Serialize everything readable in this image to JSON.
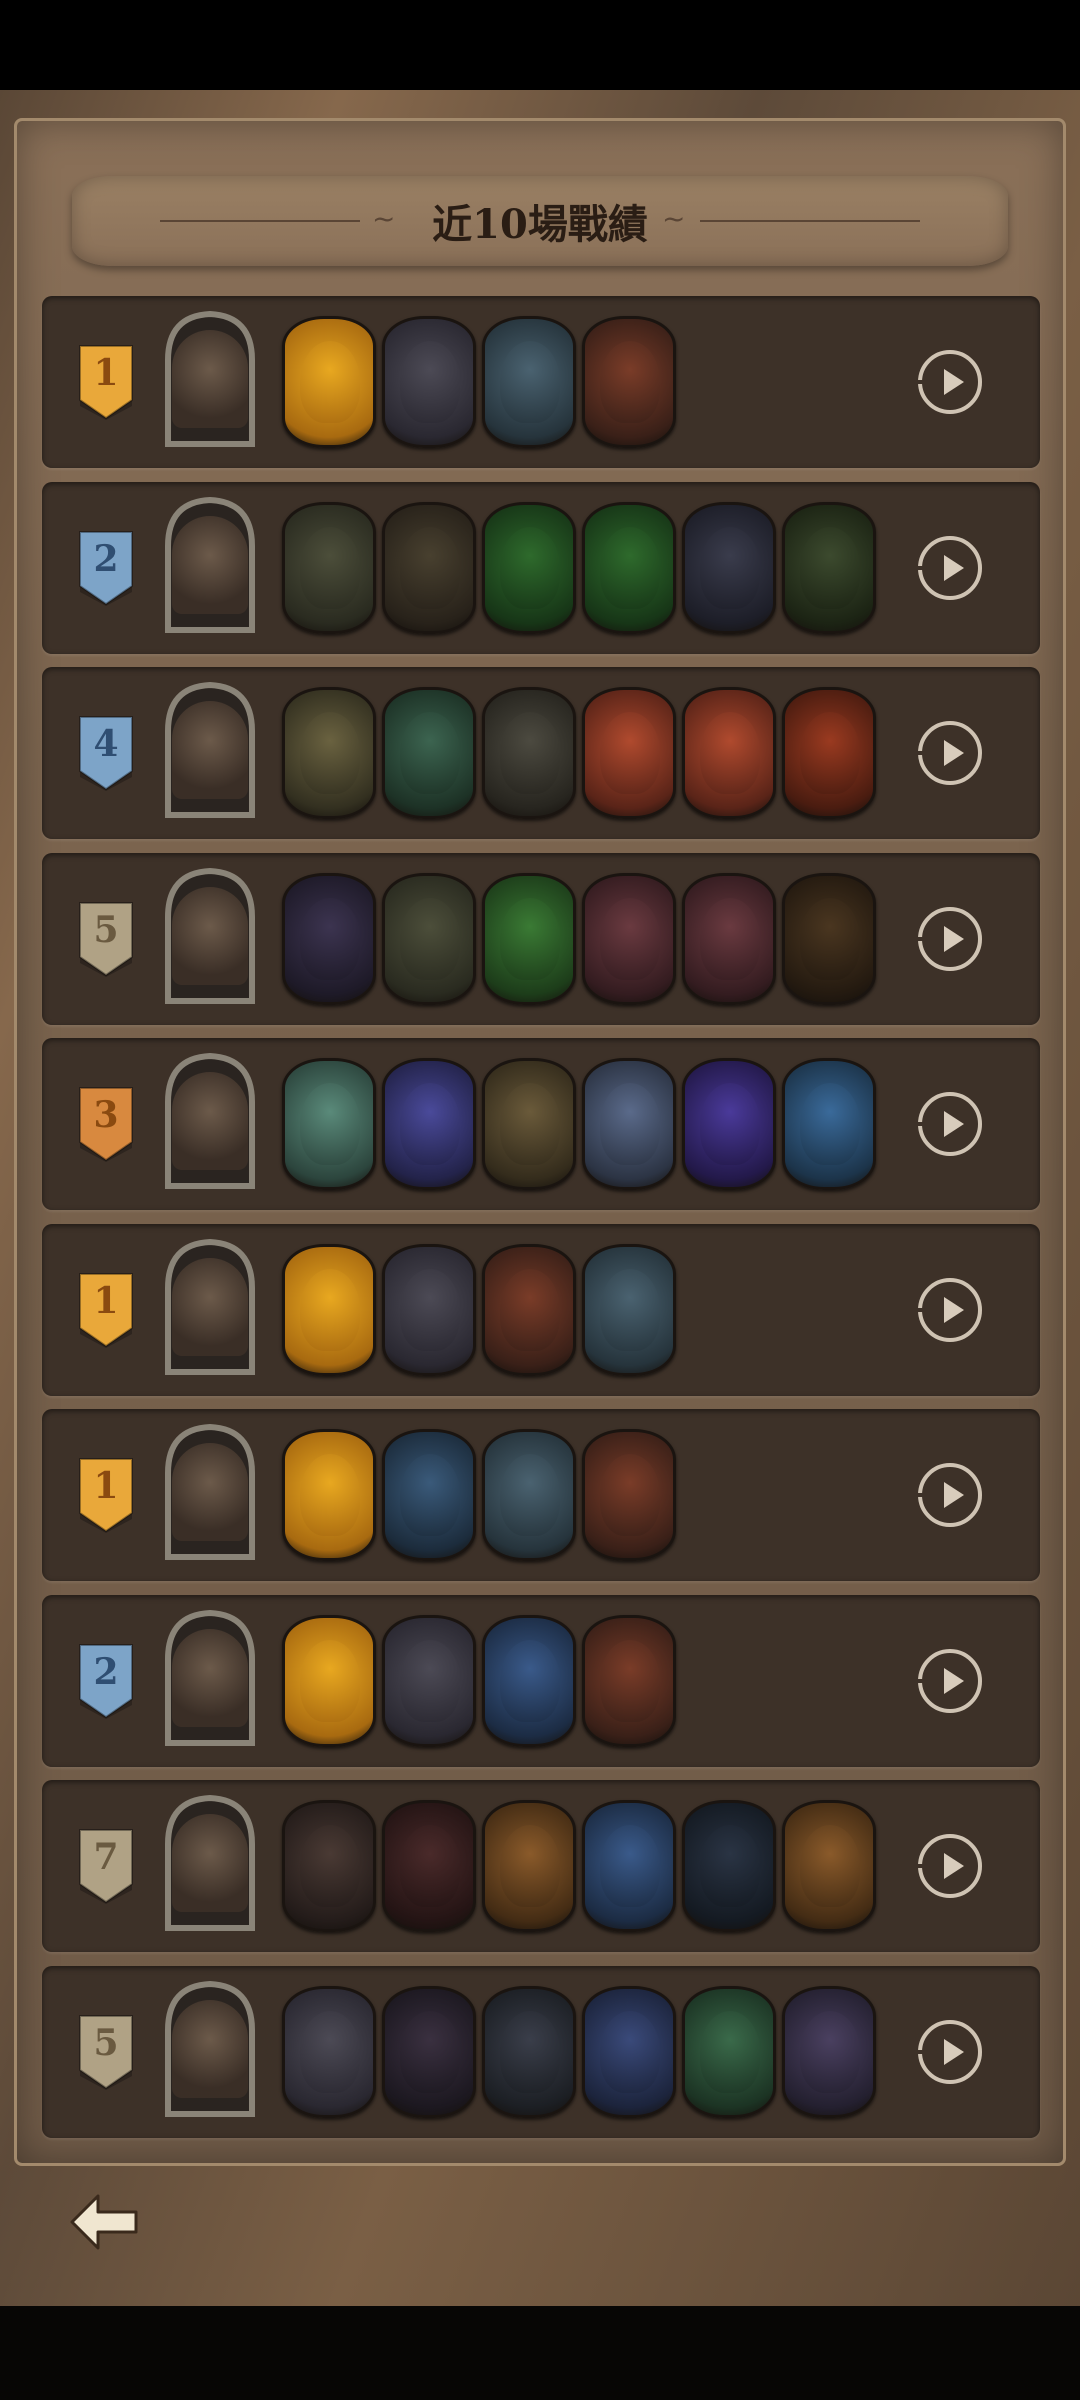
{
  "title": "近10場戰績",
  "colors": {
    "gold": "#e9a83a",
    "blue": "#7da4c8",
    "bronze": "#d8893f",
    "stone": "#b0a285"
  },
  "matches": [
    {
      "rank": "1",
      "badge": "gold",
      "hero": "hero-blue-tophat",
      "units": [
        [
          "golden-flame",
          "#e8a820",
          "#a86a10"
        ],
        [
          "grey-wolf",
          "#4c4a55",
          "#2a2831"
        ],
        [
          "winged-gargoyle",
          "#4a6270",
          "#26343c"
        ],
        [
          "red-dragon",
          "#7a3c28",
          "#3a2018"
        ]
      ]
    },
    {
      "rank": "2",
      "badge": "blue",
      "hero": "hero-antlered-elder",
      "units": [
        [
          "rock-golem",
          "#4c4e3a",
          "#2a2b20"
        ],
        [
          "hedgehog",
          "#48402f",
          "#28221a"
        ],
        [
          "green-treant",
          "#2e6a2c",
          "#173617"
        ],
        [
          "green-treant",
          "#2e6a2c",
          "#173617"
        ],
        [
          "black-horse",
          "#3a3c4c",
          "#1d1e28"
        ],
        [
          "skeleton-witch",
          "#3c4a2e",
          "#1c2414"
        ]
      ]
    },
    {
      "rank": "4",
      "badge": "blue",
      "hero": "hero-dwarf-king",
      "units": [
        [
          "armored-knight",
          "#6a6240",
          "#333020"
        ],
        [
          "lizard-mage",
          "#3c6450",
          "#1d3226"
        ],
        [
          "bearded-warrior",
          "#4c4a40",
          "#27251f"
        ],
        [
          "goblin-bomber",
          "#b04a2e",
          "#5a2418"
        ],
        [
          "goblin-bomber",
          "#b04a2e",
          "#5a2418"
        ],
        [
          "fire-imp",
          "#9a3a20",
          "#4a1c10"
        ]
      ]
    },
    {
      "rank": "5",
      "badge": "stone",
      "hero": "hero-white-haired-lady",
      "units": [
        [
          "dark-elf",
          "#3c3450",
          "#1e1a28"
        ],
        [
          "rock-golem",
          "#4c4e3a",
          "#2a2b20"
        ],
        [
          "cactus",
          "#3a7a34",
          "#1d3d1a"
        ],
        [
          "red-hair-mage",
          "#6a3a40",
          "#341c20"
        ],
        [
          "red-hair-mage",
          "#6a3a40",
          "#341c20"
        ],
        [
          "dark-treant",
          "#4a3620",
          "#241a10"
        ]
      ]
    },
    {
      "rank": "3",
      "badge": "bronze",
      "hero": "hero-gunslinger",
      "units": [
        [
          "sea-serpent",
          "#5a8a7a",
          "#2c453d"
        ],
        [
          "blue-sorceress",
          "#4a4a9a",
          "#23234a"
        ],
        [
          "gold-king",
          "#6a5a3a",
          "#342c1c"
        ],
        [
          "star-boy",
          "#5a6a8a",
          "#2c3444"
        ],
        [
          "purple-dragon",
          "#4a3a9a",
          "#23194a"
        ],
        [
          "ice-spirit",
          "#3a6a9a",
          "#1c344a"
        ]
      ]
    },
    {
      "rank": "1",
      "badge": "gold",
      "hero": "hero-anubis",
      "units": [
        [
          "golden-flame",
          "#e8a820",
          "#a86a10"
        ],
        [
          "grey-wolf",
          "#4c4a55",
          "#2a2831"
        ],
        [
          "red-dragon",
          "#7a3c28",
          "#3a2018"
        ],
        [
          "winged-gargoyle",
          "#4a6270",
          "#26343c"
        ]
      ]
    },
    {
      "rank": "1",
      "badge": "gold",
      "hero": "hero-green-haired-noble",
      "units": [
        [
          "golden-flame",
          "#e8a820",
          "#a86a10"
        ],
        [
          "beast-rider",
          "#3a5a7a",
          "#1c2c3c"
        ],
        [
          "winged-gargoyle",
          "#4a6270",
          "#26343c"
        ],
        [
          "red-dragon",
          "#7a3c28",
          "#3a2018"
        ]
      ]
    },
    {
      "rank": "2",
      "badge": "blue",
      "hero": "hero-antlered-elder",
      "units": [
        [
          "golden-flame",
          "#e8a820",
          "#a86a10"
        ],
        [
          "grey-wolf",
          "#4c4a55",
          "#2a2831"
        ],
        [
          "blue-dragonling",
          "#3a5a8a",
          "#1c2c44"
        ],
        [
          "red-dragon",
          "#7a3c28",
          "#3a2018"
        ]
      ]
    },
    {
      "rank": "7",
      "badge": "stone",
      "hero": "hero-wizard",
      "units": [
        [
          "dark-horse",
          "#4a3a34",
          "#241c1a"
        ],
        [
          "demon-warrior",
          "#4a2a2a",
          "#241414"
        ],
        [
          "reindeer",
          "#8a5a2a",
          "#442c14"
        ],
        [
          "blue-dragonling",
          "#3a5a8a",
          "#1c2c44"
        ],
        [
          "shadow-panther",
          "#2a3444",
          "#141a22"
        ],
        [
          "reindeer",
          "#8a5a2a",
          "#442c14"
        ]
      ]
    },
    {
      "rank": "5",
      "badge": "stone",
      "hero": "hero-young-scholar",
      "units": [
        [
          "grey-wolf",
          "#4c4a55",
          "#2a2831"
        ],
        [
          "skeleton-dancer",
          "#3a3040",
          "#1c1820"
        ],
        [
          "dark-knight",
          "#3a3e4a",
          "#1c1f24"
        ],
        [
          "blue-elf",
          "#3a4a7a",
          "#1c243c"
        ],
        [
          "green-ghoul",
          "#3a6a4a",
          "#1c3424"
        ],
        [
          "tentacle-sage",
          "#4a4060",
          "#242030"
        ]
      ]
    }
  ]
}
